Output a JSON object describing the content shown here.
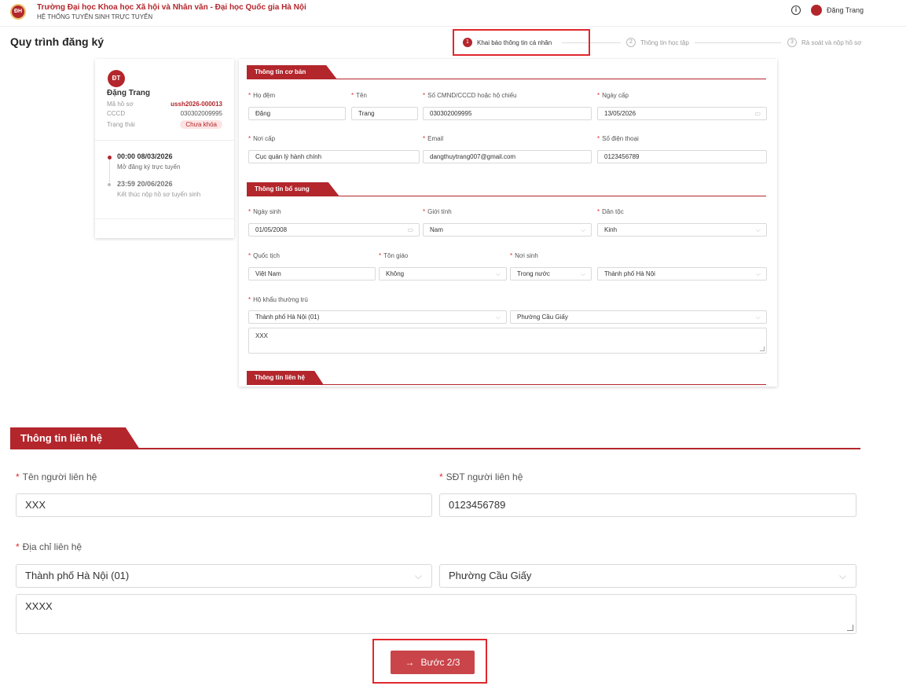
{
  "header": {
    "logo_text": "ĐH",
    "university": "Trường Đại học Khoa học Xã hội và Nhân văn - Đại học Quốc gia Hà Nội",
    "system": "HỆ THỐNG TUYỂN SINH TRỰC TUYẾN",
    "info_icon": "info-icon",
    "user_name": "Đặng Trang"
  },
  "process": {
    "title": "Quy trình đăng ký",
    "steps": [
      {
        "num": "1",
        "label": "Khai báo thông tin cá nhân",
        "active": true
      },
      {
        "num": "2",
        "label": "Thông tin học tập",
        "active": false
      },
      {
        "num": "3",
        "label": "Rà soát và nộp hồ sơ",
        "active": false
      }
    ]
  },
  "profile": {
    "initials": "ĐT",
    "name": "Đặng Trang",
    "rows": [
      {
        "label": "Mã hồ sơ",
        "value": "ussh2026-000013"
      },
      {
        "label": "CCCD",
        "value": "030302009995"
      },
      {
        "label": "Trạng thái",
        "value": "Chưa khóa"
      }
    ],
    "timeline": [
      {
        "time": "00:00 08/03/2026",
        "desc": "Mở đăng ký trực tuyến"
      },
      {
        "time": "23:59 20/06/2026",
        "desc": "Kết thúc nộp hồ sơ tuyển sinh"
      }
    ]
  },
  "form": {
    "basic": {
      "title": "Thông tin cơ bản",
      "ho_dem_label": "Họ đệm",
      "ho_dem": "Đặng",
      "ten_label": "Tên",
      "ten": "Trang",
      "cccd_label": "Số CMND/CCCD hoặc hộ chiếu",
      "cccd": "030302009995",
      "ngay_cap_label": "Ngày cấp",
      "ngay_cap": "13/05/2026",
      "noi_cap_label": "Nơi cấp",
      "noi_cap": "Cục quản lý hành chính",
      "email_label": "Email",
      "email": "dangthuytrang007@gmail.com",
      "phone_label": "Số điện thoại",
      "phone": "0123456789"
    },
    "extra": {
      "title": "Thông tin bổ sung",
      "ngay_sinh_label": "Ngày sinh",
      "ngay_sinh": "01/05/2008",
      "gioi_tinh_label": "Giới tính",
      "gioi_tinh": "Nam",
      "dan_toc_label": "Dân tộc",
      "dan_toc": "Kinh",
      "quoc_tich_label": "Quốc tịch",
      "quoc_tich": "Việt Nam",
      "ton_giao_label": "Tôn giáo",
      "ton_giao": "Không",
      "noi_sinh_label": "Nơi sinh",
      "noi_sinh_type": "Trong nước",
      "noi_sinh": "Thành phố Hà Nội",
      "ho_khau_label": "Hộ khẩu thường trú",
      "ho_khau_tinh": "Thành phố Hà Nội (01)",
      "ho_khau_phuong": "Phường Cầu Giấy",
      "ho_khau_chi_tiet": "XXX"
    },
    "contact_title": "Thông tin liên hệ"
  },
  "contact": {
    "title": "Thông tin liên hệ",
    "name_label": "Tên người liên hệ",
    "name": "XXX",
    "phone_label": "SĐT người liên hệ",
    "phone": "0123456789",
    "address_label": "Địa chỉ liên hệ",
    "province": "Thành phố Hà Nội (01)",
    "ward": "Phường Cầu Giấy",
    "detail": "XXXX"
  },
  "next_button": {
    "arrow": "→",
    "label": "Bước 2/3"
  },
  "icons": {
    "calendar": "calendar-icon",
    "chevron": "chevron-down-icon"
  }
}
